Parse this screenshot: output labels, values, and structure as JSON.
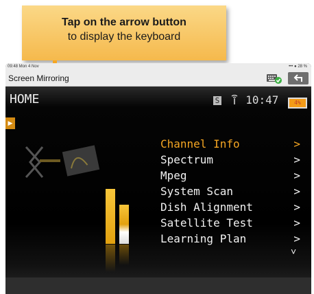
{
  "callout": {
    "line1": "Tap on the arrow button",
    "line2": "to display the keyboard"
  },
  "status_bar": {
    "time_date": "09:48  Mon 4 Nov",
    "right": "••• ● 28 %"
  },
  "mirror_bar": {
    "title": "Screen Mirroring",
    "back_icon": "back-arrow-icon",
    "keyboard_icon": "keyboard-check-icon"
  },
  "device_screen": {
    "title": "HOME",
    "signal_badge": "S",
    "antenna_symbol": "ᵗᵀ",
    "time": "10:47",
    "battery_label": "4%",
    "side_tab_icon": "▶",
    "menu": [
      {
        "label": "Channel Info",
        "chevron": ">",
        "active": true
      },
      {
        "label": "Spectrum",
        "chevron": ">",
        "active": false
      },
      {
        "label": "Mpeg",
        "chevron": ">",
        "active": false
      },
      {
        "label": "System Scan",
        "chevron": ">",
        "active": false
      },
      {
        "label": "Dish Alignment",
        "chevron": ">",
        "active": false
      },
      {
        "label": "Satellite Test",
        "chevron": ">",
        "active": false
      },
      {
        "label": "Learning Plan",
        "chevron": ">",
        "active": false
      }
    ],
    "more_indicator": "˅"
  },
  "colors": {
    "accent": "#f5a623",
    "callout_bg": "#f9c865",
    "screen_bg": "#000000"
  }
}
